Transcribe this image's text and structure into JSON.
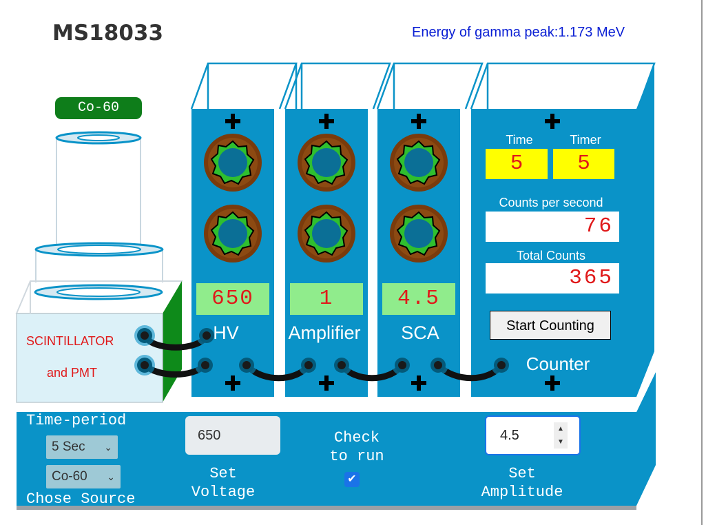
{
  "header": {
    "title": "MS18033",
    "energy_text": "Energy of gamma peak:1.173 MeV"
  },
  "source": {
    "tag": "Co-60",
    "scintillator_line1": "SCINTILLATOR",
    "scintillator_line2": "and PMT"
  },
  "modules": {
    "hv": {
      "value": "650",
      "label": "HV"
    },
    "amplifier": {
      "value": "1",
      "label": "Amplifier"
    },
    "sca": {
      "value": "4.5",
      "label": "SCA"
    },
    "counter": {
      "time_label": "Time",
      "timer_label": "Timer",
      "time_value": "5",
      "timer_value": "5",
      "cps_label": "Counts per second",
      "cps_value": "76",
      "total_label": "Total Counts",
      "total_value": "365",
      "start_button": "Start Counting",
      "label": "Counter"
    }
  },
  "controls": {
    "time_period_label": "Time-period",
    "time_period_value": "5 Sec",
    "source_value": "Co-60",
    "chose_source_label": "Chose Source",
    "voltage_value": "650",
    "set_voltage_line1": "Set",
    "set_voltage_line2": "Voltage",
    "check_line1": "Check",
    "check_line2": "to run",
    "check_checked": true,
    "amplitude_value": "4.5",
    "set_amplitude_line1": "Set",
    "set_amplitude_line2": "Amplitude"
  },
  "colors": {
    "panel_blue": "#0a93c8",
    "lcd_green": "#90ec8c",
    "readout_red": "#e0191a",
    "timer_yellow": "#ffff00",
    "title_blue": "#0a1fd4"
  }
}
